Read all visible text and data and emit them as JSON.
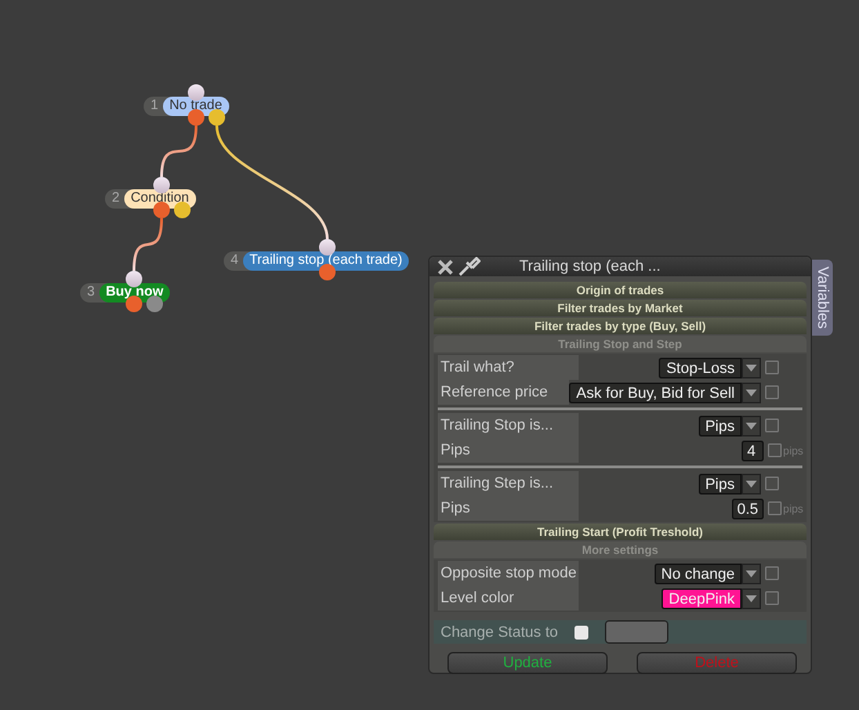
{
  "flow": {
    "number": "1",
    "label": "No trade",
    "color": "#a9c6f5",
    "outputs": [
      {
        "color": "#e8602c",
        "children": [
          {
            "number": "2",
            "label": "Condition",
            "color": "#fde2b6",
            "outputs": [
              {
                "color": "#e8602c",
                "children": [
                  {
                    "number": "3",
                    "label": "Buy now",
                    "color": "#138a22",
                    "outputs": [
                      {
                        "color": "#e8602c"
                      },
                      {
                        "color": "#8a8a8a"
                      }
                    ]
                  }
                ]
              },
              {
                "color": "#e6bd2e"
              }
            ]
          }
        ]
      },
      {
        "color": "#e6bd2e",
        "children": [
          {
            "number": "4",
            "label": "Trailing stop (each trade)",
            "color": "#3b7fbe",
            "outputs": [
              {
                "color": "#e8602c"
              }
            ]
          }
        ]
      }
    ]
  },
  "panel": {
    "title": "Trailing stop (each ...",
    "side_tab": "Variables",
    "sections": [
      {
        "title": "Origin of trades",
        "expanded": false
      },
      {
        "title": "Filter trades by Market",
        "expanded": false
      },
      {
        "title": "Filter trades by type (Buy, Sell)",
        "expanded": false
      },
      {
        "title": "Trailing Stop and Step",
        "expanded": true,
        "groups": [
          [
            {
              "label": "Trail what?",
              "kind": "dropdown",
              "value": "Stop-Loss",
              "checked": false
            },
            {
              "label": "Reference price",
              "kind": "dropdown",
              "value": "Ask for Buy, Bid for Sell",
              "checked": false
            }
          ],
          [
            {
              "label": "Trailing Stop is...",
              "kind": "dropdown",
              "value": "Pips",
              "checked": false
            },
            {
              "label": "Pips",
              "kind": "number",
              "value": "4",
              "checked": false,
              "unit": "pips"
            }
          ],
          [
            {
              "label": "Trailing Step is...",
              "kind": "dropdown",
              "value": "Pips",
              "checked": false
            },
            {
              "label": "Pips",
              "kind": "number",
              "value": "0.5",
              "checked": false,
              "unit": "pips"
            }
          ]
        ]
      },
      {
        "title": "Trailing Start (Profit Treshold)",
        "expanded": false
      },
      {
        "title": "More settings",
        "expanded": true,
        "groups": [
          [
            {
              "label": "Opposite stop mode",
              "kind": "dropdown",
              "value": "No change",
              "checked": false
            },
            {
              "label": "Level color",
              "kind": "dropdown",
              "value": "DeepPink",
              "checked": false,
              "color": "#ff1493"
            }
          ]
        ]
      }
    ],
    "status": {
      "label": "Change Status to",
      "checked": false
    },
    "buttons": [
      {
        "label": "Update",
        "kind": "confirm"
      },
      {
        "label": "Delete",
        "kind": "danger"
      }
    ]
  }
}
